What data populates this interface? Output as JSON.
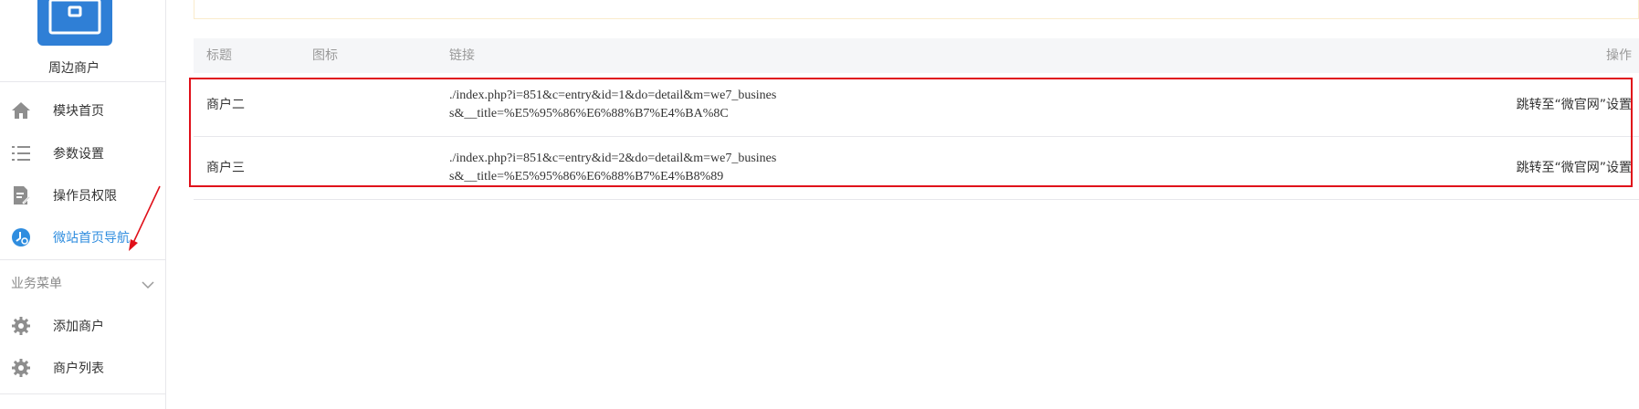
{
  "sidebar": {
    "module_name": "周边商户",
    "nav_items": [
      {
        "label": "模块首页",
        "icon": "home-icon"
      },
      {
        "label": "参数设置",
        "icon": "list-icon"
      },
      {
        "label": "操作员权限",
        "icon": "document-edit-icon"
      },
      {
        "label": "微站首页导航",
        "icon": "clock-icon",
        "active": true
      }
    ],
    "group": {
      "label": "业务菜单",
      "items": [
        {
          "label": "添加商户",
          "icon": "gear-icon"
        },
        {
          "label": "商户列表",
          "icon": "gear-icon"
        }
      ]
    }
  },
  "table": {
    "headers": {
      "title": "标题",
      "icon": "图标",
      "link": "链接",
      "action": "操作"
    },
    "rows": [
      {
        "title": "商户二",
        "link": "./index.php?i=851&c=entry&id=1&do=detail&m=we7_business&__title=%E5%95%86%E6%88%B7%E4%BA%8C",
        "action": "跳转至“微官网”设置"
      },
      {
        "title": "商户三",
        "link": "./index.php?i=851&c=entry&id=2&do=detail&m=we7_business&__title=%E5%95%86%E6%88%B7%E4%B8%89",
        "action": "跳转至“微官网”设置"
      }
    ]
  },
  "colors": {
    "accent": "#2f8ddf",
    "highlight": "#e0101a",
    "header_bg": "#f5f6f8",
    "logo": "#2f7fd6"
  }
}
